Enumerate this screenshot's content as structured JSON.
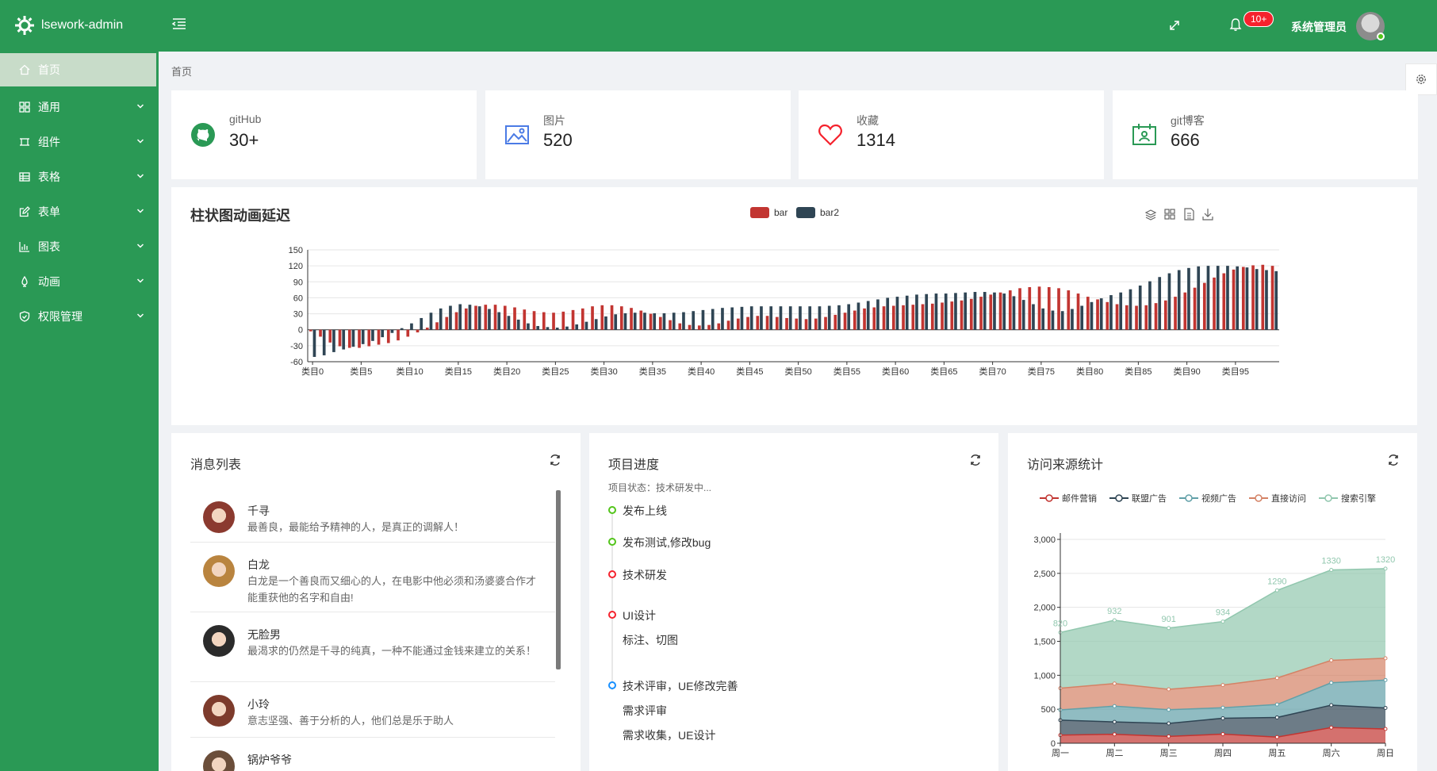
{
  "app": {
    "title": "lsework-admin"
  },
  "header": {
    "badge": "10+",
    "username": "系统管理员"
  },
  "sidebar": {
    "items": [
      {
        "label": "首页",
        "icon": "home-icon",
        "active": true
      },
      {
        "label": "通用",
        "icon": "grid-icon"
      },
      {
        "label": "组件",
        "icon": "component-icon"
      },
      {
        "label": "表格",
        "icon": "table-icon"
      },
      {
        "label": "表单",
        "icon": "edit-icon"
      },
      {
        "label": "图表",
        "icon": "chart-icon"
      },
      {
        "label": "动画",
        "icon": "animation-icon"
      },
      {
        "label": "权限管理",
        "icon": "shield-icon"
      }
    ]
  },
  "breadcrumb": "首页",
  "stats": [
    {
      "label": "gitHub",
      "value": "30+",
      "icon": "github-icon",
      "color": "#2a9955"
    },
    {
      "label": "图片",
      "value": "520",
      "icon": "image-icon",
      "color": "#4b7be5"
    },
    {
      "label": "收藏",
      "value": "1314",
      "icon": "heart-icon",
      "color": "#f5222d"
    },
    {
      "label": "git博客",
      "value": "666",
      "icon": "calendar-user-icon",
      "color": "#2a9955"
    }
  ],
  "bar_chart": {
    "title": "柱状图动画延迟",
    "toolbox": [
      "stack-icon",
      "grid-view-icon",
      "data-view-icon",
      "download-icon"
    ]
  },
  "messages": {
    "title": "消息列表",
    "items": [
      {
        "name": "千寻",
        "text": "最善良，最能给予精神的人，是真正的调解人！"
      },
      {
        "name": "白龙",
        "text": "白龙是一个善良而又细心的人，在电影中他必须和汤婆婆合作才能重获他的名字和自由!"
      },
      {
        "name": "无脸男",
        "text": "最渴求的仍然是千寻的纯真，一种不能通过金钱来建立的关系！"
      },
      {
        "name": "小玲",
        "text": "意志坚强、善于分析的人，他们总是乐于助人"
      },
      {
        "name": "锅炉爷爷",
        "text": ""
      }
    ]
  },
  "progress": {
    "title": "项目进度",
    "status": "项目状态：技术研发中...",
    "items": [
      {
        "text": "发布上线",
        "color": "#52c41a"
      },
      {
        "text": "发布测试,修改bug",
        "color": "#52c41a"
      },
      {
        "text": "技术研发",
        "color": "#f5222d"
      },
      {
        "text": "UI设计",
        "sub": "标注、切图",
        "color": "#f5222d"
      },
      {
        "text": "技术评审，UE修改完善",
        "sub": "需求评审",
        "sub2": "需求收集，UE设计",
        "color": "#1890ff"
      }
    ]
  },
  "visits": {
    "title": "访问来源统计"
  },
  "chart_data": [
    {
      "type": "bar",
      "title": "柱状图动画延迟",
      "series": [
        {
          "name": "bar",
          "values": [
            -3,
            -13,
            -24,
            -31,
            -34,
            -34,
            -31,
            -28,
            -25,
            -20,
            -13,
            -5,
            4,
            14,
            24,
            33,
            40,
            45,
            47,
            47,
            45,
            42,
            38,
            35,
            33,
            32,
            34,
            37,
            40,
            44,
            46,
            46,
            44,
            41,
            36,
            30,
            24,
            18,
            12,
            9,
            8,
            9,
            12,
            17,
            21,
            24,
            26,
            26,
            24,
            22,
            21,
            20,
            21,
            24,
            28,
            32,
            36,
            40,
            42,
            44,
            45,
            46,
            47,
            48,
            49,
            51,
            53,
            55,
            58,
            62,
            66,
            70,
            74,
            78,
            80,
            81,
            80,
            78,
            74,
            68,
            62,
            57,
            52,
            48,
            46,
            45,
            46,
            50,
            55,
            62,
            70,
            79,
            88,
            98,
            106,
            113,
            118,
            121,
            122,
            120
          ],
          "color": "#c23531"
        },
        {
          "name": "bar2",
          "values": [
            -51,
            -48,
            -42,
            -37,
            -32,
            -27,
            -21,
            -14,
            -6,
            3,
            12,
            22,
            32,
            40,
            45,
            48,
            47,
            44,
            39,
            33,
            26,
            19,
            12,
            7,
            5,
            4,
            6,
            10,
            15,
            20,
            25,
            29,
            31,
            32,
            32,
            31,
            31,
            32,
            33,
            35,
            37,
            39,
            41,
            42,
            43,
            44,
            44,
            44,
            44,
            44,
            44,
            44,
            44,
            45,
            46,
            48,
            51,
            54,
            57,
            60,
            62,
            64,
            66,
            67,
            68,
            68,
            69,
            70,
            71,
            71,
            70,
            68,
            63,
            56,
            48,
            40,
            36,
            35,
            39,
            45,
            52,
            59,
            65,
            70,
            76,
            83,
            91,
            99,
            106,
            112,
            116,
            119,
            120,
            120,
            120,
            119,
            117,
            114,
            112,
            110
          ],
          "color": "#2f4554"
        }
      ],
      "categories_label_prefix": "类目",
      "x_tick_labels": [
        "类目0",
        "类目5",
        "类目10",
        "类目15",
        "类目20",
        "类目25",
        "类目30",
        "类目35",
        "类目40",
        "类目45",
        "类目50",
        "类目55",
        "类目60",
        "类目65",
        "类目70",
        "类目75",
        "类目80",
        "类目85",
        "类目90",
        "类目95"
      ],
      "y_ticks": [
        150,
        120,
        90,
        60,
        30,
        0,
        -30,
        -60
      ],
      "ylim": [
        -60,
        150
      ],
      "legend": "top-center"
    },
    {
      "type": "area",
      "title": "访问来源统计",
      "categories": [
        "周一",
        "周二",
        "周三",
        "周四",
        "周五",
        "周六",
        "周日"
      ],
      "series": [
        {
          "name": "邮件营销",
          "values": [
            120,
            132,
            101,
            134,
            90,
            230,
            210
          ],
          "color": "#c23531"
        },
        {
          "name": "联盟广告",
          "values": [
            220,
            182,
            191,
            234,
            290,
            330,
            310
          ],
          "color": "#2f4554"
        },
        {
          "name": "视频广告",
          "values": [
            150,
            232,
            201,
            154,
            190,
            330,
            410
          ],
          "color": "#61a0a8"
        },
        {
          "name": "直接访问",
          "values": [
            320,
            332,
            301,
            334,
            390,
            330,
            320
          ],
          "color": "#d48265"
        },
        {
          "name": "搜索引擎",
          "values": [
            820,
            932,
            901,
            934,
            1290,
            1330,
            1320
          ],
          "color": "#91c7ae"
        }
      ],
      "data_labels": [
        "820",
        "932",
        "901",
        "934",
        "1290",
        "1330",
        "1320"
      ],
      "y_ticks": [
        "3,000",
        "2,500",
        "2,000",
        "1,500",
        "1,000",
        "500",
        "0"
      ],
      "ylim": [
        0,
        3000
      ],
      "stacked": true,
      "legend": "top"
    }
  ]
}
